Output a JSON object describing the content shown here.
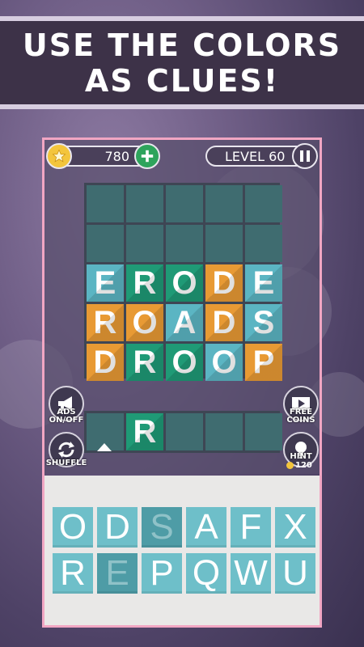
{
  "banner": {
    "line1": "USE THE COLORS",
    "line2": "AS CLUES!"
  },
  "header": {
    "coins": "780",
    "level": "LEVEL 60"
  },
  "grid": {
    "rows": [
      [
        {
          "l": "",
          "c": "empty"
        },
        {
          "l": "",
          "c": "empty"
        },
        {
          "l": "",
          "c": "empty"
        },
        {
          "l": "",
          "c": "empty"
        },
        {
          "l": "",
          "c": "empty"
        }
      ],
      [
        {
          "l": "",
          "c": "empty"
        },
        {
          "l": "",
          "c": "empty"
        },
        {
          "l": "",
          "c": "empty"
        },
        {
          "l": "",
          "c": "empty"
        },
        {
          "l": "",
          "c": "empty"
        }
      ],
      [
        {
          "l": "E",
          "c": "blue"
        },
        {
          "l": "R",
          "c": "green"
        },
        {
          "l": "O",
          "c": "green"
        },
        {
          "l": "D",
          "c": "orange"
        },
        {
          "l": "E",
          "c": "blue"
        }
      ],
      [
        {
          "l": "R",
          "c": "orange"
        },
        {
          "l": "O",
          "c": "orange"
        },
        {
          "l": "A",
          "c": "blue"
        },
        {
          "l": "D",
          "c": "orange"
        },
        {
          "l": "S",
          "c": "blue"
        }
      ],
      [
        {
          "l": "D",
          "c": "orange"
        },
        {
          "l": "R",
          "c": "green"
        },
        {
          "l": "O",
          "c": "green"
        },
        {
          "l": "O",
          "c": "blue"
        },
        {
          "l": "P",
          "c": "orange"
        }
      ]
    ]
  },
  "answer": [
    {
      "l": "",
      "c": "empty"
    },
    {
      "l": "R",
      "c": "green"
    },
    {
      "l": "",
      "c": "empty"
    },
    {
      "l": "",
      "c": "empty"
    },
    {
      "l": "",
      "c": "empty"
    }
  ],
  "side": {
    "ads": "ADS\nON/OFF",
    "shuffle": "SHUFFLE",
    "free_coins": "FREE\nCOINS",
    "hint": "HINT",
    "hint_cost": "120"
  },
  "keyboard": {
    "row1": [
      {
        "l": "O",
        "used": false
      },
      {
        "l": "D",
        "used": false
      },
      {
        "l": "S",
        "used": true
      },
      {
        "l": "A",
        "used": false
      },
      {
        "l": "F",
        "used": false
      },
      {
        "l": "X",
        "used": false
      }
    ],
    "row2": [
      {
        "l": "R",
        "used": false
      },
      {
        "l": "E",
        "used": true
      },
      {
        "l": "P",
        "used": false
      },
      {
        "l": "Q",
        "used": false
      },
      {
        "l": "W",
        "used": false
      },
      {
        "l": "U",
        "used": false
      }
    ]
  },
  "colors": {
    "blue": "#5bb5c3",
    "green": "#1f9a76",
    "orange": "#e89a34",
    "empty": "#3f6c70"
  }
}
